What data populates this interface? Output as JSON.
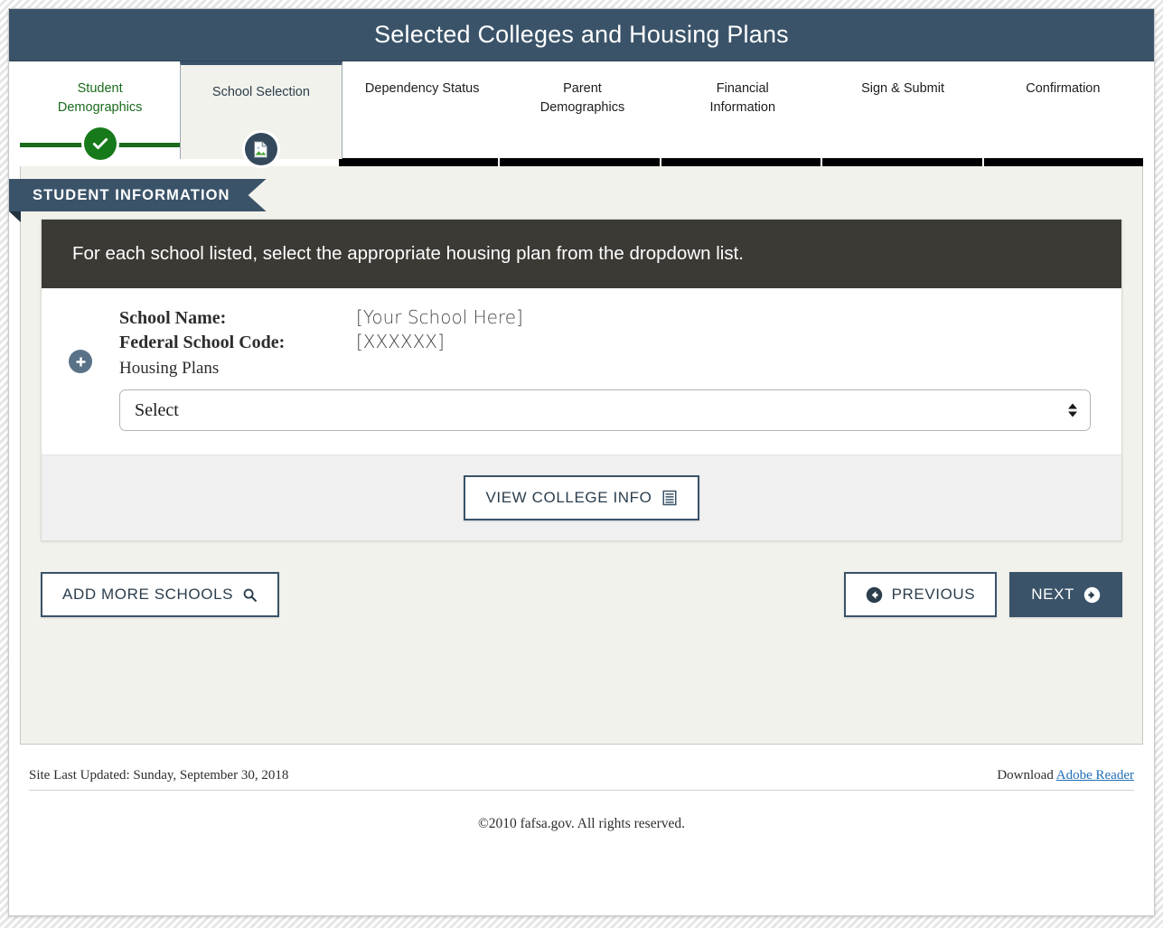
{
  "window": {
    "title": "Selected Colleges and Housing Plans"
  },
  "tabs": [
    {
      "label": "Student\nDemographics",
      "line1": "Student",
      "line2": "Demographics",
      "state": "completed",
      "icon": "check-circle-icon"
    },
    {
      "label": "School Selection",
      "line1": "School Selection",
      "line2": "",
      "state": "active",
      "icon": "document-page-icon"
    },
    {
      "label": "Dependency Status",
      "line1": "Dependency Status",
      "line2": "",
      "state": "upcoming",
      "icon": ""
    },
    {
      "label": "Parent Demographics",
      "line1": "Parent",
      "line2": "Demographics",
      "state": "upcoming",
      "icon": ""
    },
    {
      "label": "Financial Information",
      "line1": "Financial",
      "line2": "Information",
      "state": "upcoming",
      "icon": ""
    },
    {
      "label": "Sign & Submit",
      "line1": "Sign & Submit",
      "line2": "",
      "state": "upcoming",
      "icon": ""
    },
    {
      "label": "Confirmation",
      "line1": "Confirmation",
      "line2": "",
      "state": "upcoming",
      "icon": ""
    }
  ],
  "section": {
    "ribbon_title": "STUDENT INFORMATION",
    "instruction": "For each school listed, select the appropriate housing plan from the dropdown list."
  },
  "school": {
    "expand_icon": "plus-circle-icon",
    "name_label": "School Name:",
    "name_value": "[Your School Here]",
    "code_label": "Federal School Code:",
    "code_value": "[XXXXXX]",
    "housing_label": "Housing Plans",
    "housing_selected": "Select",
    "housing_options": [
      "Select"
    ],
    "view_info_label": "VIEW COLLEGE INFO",
    "view_info_icon": "list-document-icon"
  },
  "actions": {
    "add_schools_label": "ADD MORE SCHOOLS",
    "add_schools_icon": "search-icon",
    "previous_label": "PREVIOUS",
    "previous_icon": "arrow-left-circle-icon",
    "next_label": "NEXT",
    "next_icon": "arrow-right-circle-icon"
  },
  "footer": {
    "last_updated": "Site Last Updated: Sunday, September 30, 2018",
    "download_text": "Download",
    "download_link": "Adobe Reader",
    "copyright": "©2010 fafsa.gov. All rights reserved."
  },
  "colors": {
    "brand": "#3a5369",
    "completed": "#167a1b",
    "instruction_bar": "#3c3a35",
    "panel": "#f2f2ec",
    "link": "#1f6fb5"
  }
}
